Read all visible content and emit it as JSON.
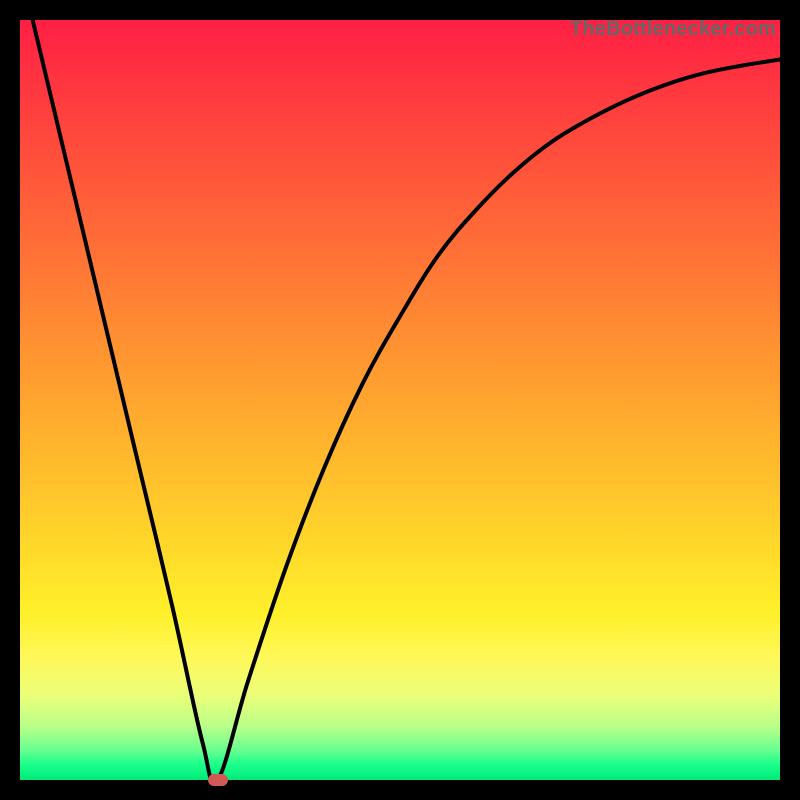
{
  "watermark": "TheBottlenecker.com",
  "colors": {
    "frame": "#000000",
    "curve": "#000000",
    "marker": "#d15a56"
  },
  "chart_data": {
    "type": "line",
    "title": "",
    "xlabel": "",
    "ylabel": "",
    "xlim": [
      0,
      100
    ],
    "ylim": [
      0,
      100
    ],
    "series": [
      {
        "name": "bottleneck-curve",
        "x": [
          0,
          5,
          10,
          15,
          20,
          24,
          26,
          30,
          35,
          40,
          45,
          50,
          55,
          60,
          65,
          70,
          75,
          80,
          85,
          90,
          95,
          100
        ],
        "y": [
          107,
          86,
          65,
          44,
          23,
          5,
          0,
          13,
          28,
          41,
          52,
          61,
          69,
          75,
          80,
          84,
          87,
          89.5,
          91.5,
          93,
          94,
          94.8
        ]
      }
    ],
    "annotations": [
      {
        "name": "optimal-point",
        "x": 26,
        "y": 0
      }
    ],
    "gradient_stops": [
      {
        "pos": 0,
        "color": "#ff1f44"
      },
      {
        "pos": 50,
        "color": "#ffba2c"
      },
      {
        "pos": 80,
        "color": "#fff02a"
      },
      {
        "pos": 100,
        "color": "#00e97a"
      }
    ]
  }
}
